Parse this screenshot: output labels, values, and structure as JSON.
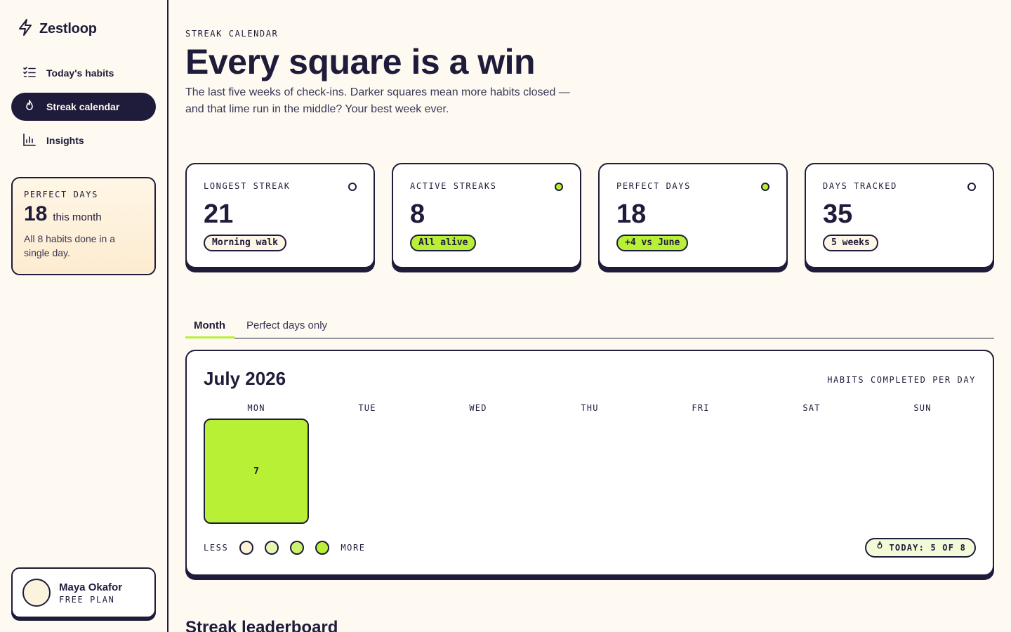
{
  "app": {
    "name": "Zestloop"
  },
  "sidebar": {
    "items": [
      {
        "label": "Today's habits",
        "icon": "checklist-icon",
        "active": false
      },
      {
        "label": "Streak calendar",
        "icon": "flame-icon",
        "active": true
      },
      {
        "label": "Insights",
        "icon": "bar-chart-icon",
        "active": false
      }
    ],
    "perfect_days": {
      "label": "PERFECT DAYS",
      "value": "18",
      "suffix": "this month",
      "description": "All 8 habits done in a single day."
    },
    "user": {
      "name": "Maya Okafor",
      "plan": "FREE PLAN"
    }
  },
  "header": {
    "eyebrow": "STREAK CALENDAR",
    "title": "Every square is a win",
    "description": "The last five weeks of check-ins. Darker squares mean more habits closed — and that lime run in the middle? Your best week ever."
  },
  "stats": [
    {
      "label": "LONGEST STREAK",
      "value": "21",
      "pill": "Morning walk",
      "accent": false
    },
    {
      "label": "ACTIVE STREAKS",
      "value": "8",
      "pill": "All alive",
      "accent": true
    },
    {
      "label": "PERFECT DAYS",
      "value": "18",
      "pill": "+4 vs June",
      "accent": true
    },
    {
      "label": "DAYS TRACKED",
      "value": "35",
      "pill": "5 weeks",
      "accent": false
    }
  ],
  "tabs": [
    {
      "label": "Month",
      "active": true
    },
    {
      "label": "Perfect days only",
      "active": false
    }
  ],
  "calendar": {
    "title": "July 2026",
    "caption": "HABITS COMPLETED PER DAY",
    "weekdays": [
      "MON",
      "TUE",
      "WED",
      "THU",
      "FRI",
      "SAT",
      "SUN"
    ],
    "days": [
      {
        "weekday": "MON",
        "count": "7"
      }
    ],
    "legend": {
      "less": "LESS",
      "more": "MORE",
      "colors": [
        "#fdf1d8",
        "#e6f7b4",
        "#cdf26b",
        "#b8f036"
      ]
    },
    "today": "TODAY: 5 OF 8"
  },
  "leaderboard": {
    "title": "Streak leaderboard"
  },
  "colors": {
    "ink": "#1f1b3a",
    "lime": "#b8f036",
    "cream": "#fefaf2"
  }
}
